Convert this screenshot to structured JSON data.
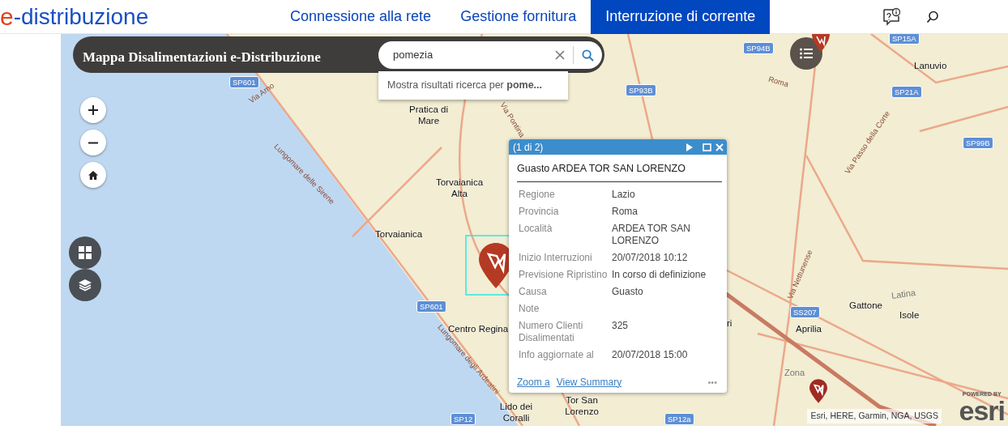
{
  "header": {
    "logo_mark": "e",
    "logo_text": "-distribuzione",
    "nav": [
      {
        "label": "Connessione alla rete",
        "selected": false
      },
      {
        "label": "Gestione fornitura",
        "selected": false
      },
      {
        "label": "Interruzione di corrente",
        "selected": true
      }
    ]
  },
  "map": {
    "title": "Mappa Disalimentazioni e-Distribuzione",
    "search": {
      "value": "pomezia",
      "suggestion": "Mostra risultati ricerca per **pome...**"
    },
    "labels": [
      {
        "kind": "place",
        "text": "Pratica di Mare"
      },
      {
        "kind": "place",
        "text": "Torvaianica Alta"
      },
      {
        "kind": "place",
        "text": "Torvaianica"
      },
      {
        "kind": "place",
        "text": "Centro Regina"
      },
      {
        "kind": "place",
        "text": "Lido dei Coralli"
      },
      {
        "kind": "place",
        "text": "Tor San Lorenzo"
      },
      {
        "kind": "place",
        "text": "Lanuvio"
      },
      {
        "kind": "place",
        "text": "Gattone"
      },
      {
        "kind": "place",
        "text": "Isole"
      },
      {
        "kind": "place",
        "text": "Aprilia"
      },
      {
        "kind": "place",
        "text": "ri"
      },
      {
        "kind": "area",
        "text": "Zona"
      },
      {
        "kind": "shield",
        "text": "SP601"
      },
      {
        "kind": "shield",
        "text": "SP601"
      },
      {
        "kind": "shield",
        "text": "SP93B"
      },
      {
        "kind": "shield",
        "text": "SP94B"
      },
      {
        "kind": "shield",
        "text": "SP15A"
      },
      {
        "kind": "shield",
        "text": "SP21A"
      },
      {
        "kind": "shield",
        "text": "SP99B"
      },
      {
        "kind": "shield",
        "text": "SS207"
      },
      {
        "kind": "shield",
        "text": "SP12"
      },
      {
        "kind": "shield",
        "text": "SP12a"
      },
      {
        "kind": "road",
        "text": "Lungomare delle Sirene"
      },
      {
        "kind": "road",
        "text": "Lungomare degli Ardeatini"
      },
      {
        "kind": "road",
        "text": "Via Arno"
      },
      {
        "kind": "road",
        "text": "Via Pontina"
      },
      {
        "kind": "road",
        "text": "Roma"
      },
      {
        "kind": "road",
        "text": "Via Passo della Corte"
      },
      {
        "kind": "road",
        "text": "Via Nettunense"
      },
      {
        "kind": "area",
        "text": "Latina"
      }
    ],
    "popup": {
      "counter": "(1 di 2)",
      "title": "Guasto ARDEA TOR SAN LORENZO",
      "fields": [
        {
          "label": "Regione",
          "value": "Lazio"
        },
        {
          "label": "Provincia",
          "value": "Roma"
        },
        {
          "label": "Località",
          "value": "ARDEA TOR SAN LORENZO"
        },
        {
          "label": "Inizio Interruzioni",
          "value": "20/07/2018 10:12"
        },
        {
          "label": "Previsione Ripristino",
          "value": "In corso di definizione"
        },
        {
          "label": "Causa",
          "value": "Guasto"
        },
        {
          "label": "Note"
        },
        {
          "label": "Numero Clienti Disalimentati",
          "value": "325"
        },
        {
          "label": "Info aggiornate al",
          "value": "20/07/2018 15:00"
        }
      ],
      "links": [
        "Zoom a",
        "View Summary"
      ],
      "more": "•••"
    },
    "attribution": "Esri, HERE, Garmin, NGA, USGS",
    "esri": {
      "powered": "POWERED BY",
      "brand": "esri"
    }
  }
}
